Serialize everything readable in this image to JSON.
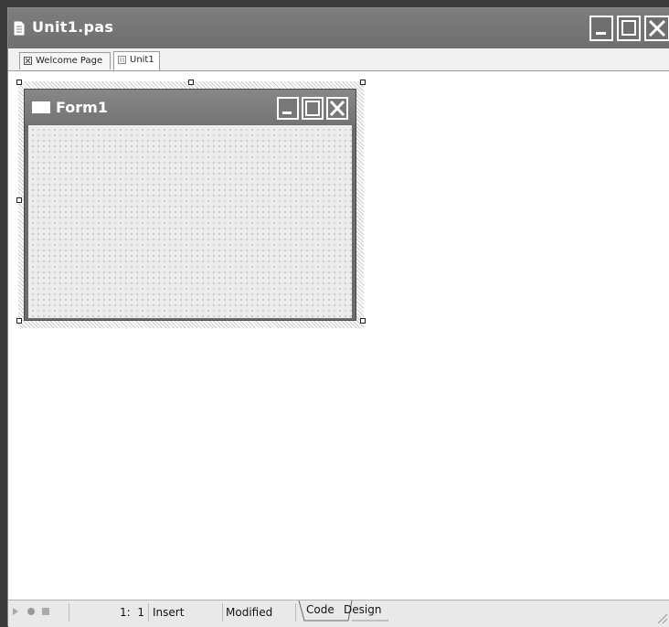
{
  "window": {
    "title": "Unit1.pas",
    "buttons": [
      "minimize",
      "maximize",
      "close"
    ]
  },
  "tabs": [
    {
      "label": "Welcome Page",
      "icon": "close-box-icon",
      "active": false
    },
    {
      "label": "Unit1",
      "icon": "form-grid-icon",
      "active": true
    }
  ],
  "form": {
    "title": "Form1"
  },
  "statusbar": {
    "position": "1:  1",
    "mode": "Insert",
    "state": "Modified",
    "tabs": [
      "Code",
      "Design"
    ]
  },
  "colors": {
    "titlebar": "#727272",
    "form_caption": "#7d7d7d",
    "designer_bg": "#ffffff",
    "grid_bg": "#ececec"
  }
}
